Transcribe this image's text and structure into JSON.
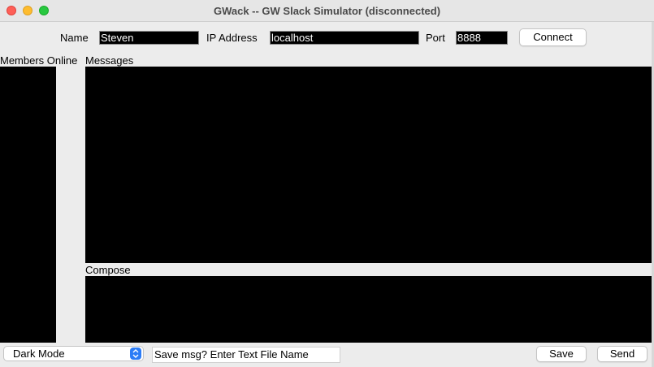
{
  "window": {
    "title": "GWack -- GW Slack Simulator (disconnected)"
  },
  "connection": {
    "name_label": "Name",
    "name_value": "Steven",
    "ip_label": "IP Address",
    "ip_value": "localhost",
    "port_label": "Port",
    "port_value": "8888",
    "connect_label": "Connect"
  },
  "sections": {
    "members_label": "Members Online",
    "messages_label": "Messages",
    "compose_label": "Compose"
  },
  "footer": {
    "mode_selected": "Dark Mode",
    "save_file_value": "Save msg? Enter Text File Name",
    "save_label": "Save",
    "send_label": "Send"
  },
  "colors": {
    "panel_background": "#000000",
    "window_background": "#ececec",
    "accent": "#2b7cf6"
  },
  "icons": {
    "close": "close-icon",
    "minimize": "minimize-icon",
    "zoom": "zoom-icon",
    "select_arrows": "chevron-up-down-icon"
  }
}
